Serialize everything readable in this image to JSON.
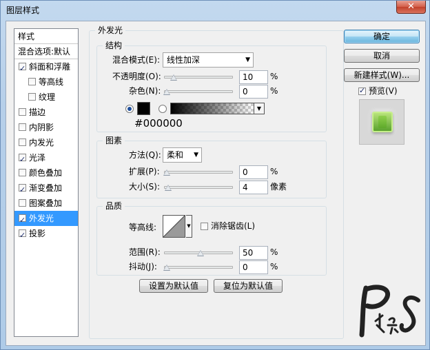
{
  "window": {
    "title": "图层样式",
    "close_glyph": "✕"
  },
  "styles_list": {
    "header": "样式",
    "blend_header": "混合选项:默认",
    "items": [
      {
        "label": "斜面和浮雕",
        "checked": true
      },
      {
        "label": "等高线",
        "checked": false
      },
      {
        "label": "纹理",
        "checked": false
      },
      {
        "label": "描边",
        "checked": false
      },
      {
        "label": "内阴影",
        "checked": false
      },
      {
        "label": "内发光",
        "checked": false
      },
      {
        "label": "光泽",
        "checked": true
      },
      {
        "label": "颜色叠加",
        "checked": false
      },
      {
        "label": "渐变叠加",
        "checked": true
      },
      {
        "label": "图案叠加",
        "checked": false
      },
      {
        "label": "外发光",
        "checked": true,
        "selected": true
      },
      {
        "label": "投影",
        "checked": true
      }
    ]
  },
  "panel": {
    "title": "外发光",
    "structure": {
      "title": "结构",
      "blend_mode_label": "混合模式(E):",
      "blend_mode_value": "线性加深",
      "opacity_label": "不透明度(O):",
      "opacity_value": "10",
      "noise_label": "杂色(N):",
      "noise_value": "0",
      "percent": "%",
      "color_hex": "#000000",
      "color": "#000000",
      "opacity_fraction": 0.1,
      "noise_fraction": 0.0
    },
    "elements": {
      "title": "图素",
      "method_label": "方法(Q):",
      "method_value": "柔和",
      "spread_label": "扩展(P):",
      "spread_value": "0",
      "size_label": "大小(S):",
      "size_value": "4",
      "percent": "%",
      "pixels": "像素",
      "spread_fraction": 0.0,
      "size_fraction": 0.016
    },
    "quality": {
      "title": "品质",
      "contour_label": "等高线:",
      "anti_alias_label": "消除锯齿(L)",
      "anti_alias_checked": false,
      "range_label": "范围(R):",
      "range_value": "50",
      "jitter_label": "抖动(J):",
      "jitter_value": "0",
      "percent": "%",
      "range_fraction": 0.5,
      "jitter_fraction": 0.0
    },
    "make_default": "设置为默认值",
    "reset_default": "复位为默认值"
  },
  "buttons": {
    "ok": "确定",
    "cancel": "取消",
    "new_style": "新建样式(W)...",
    "preview_label": "预览(V)",
    "preview_checked": true
  }
}
